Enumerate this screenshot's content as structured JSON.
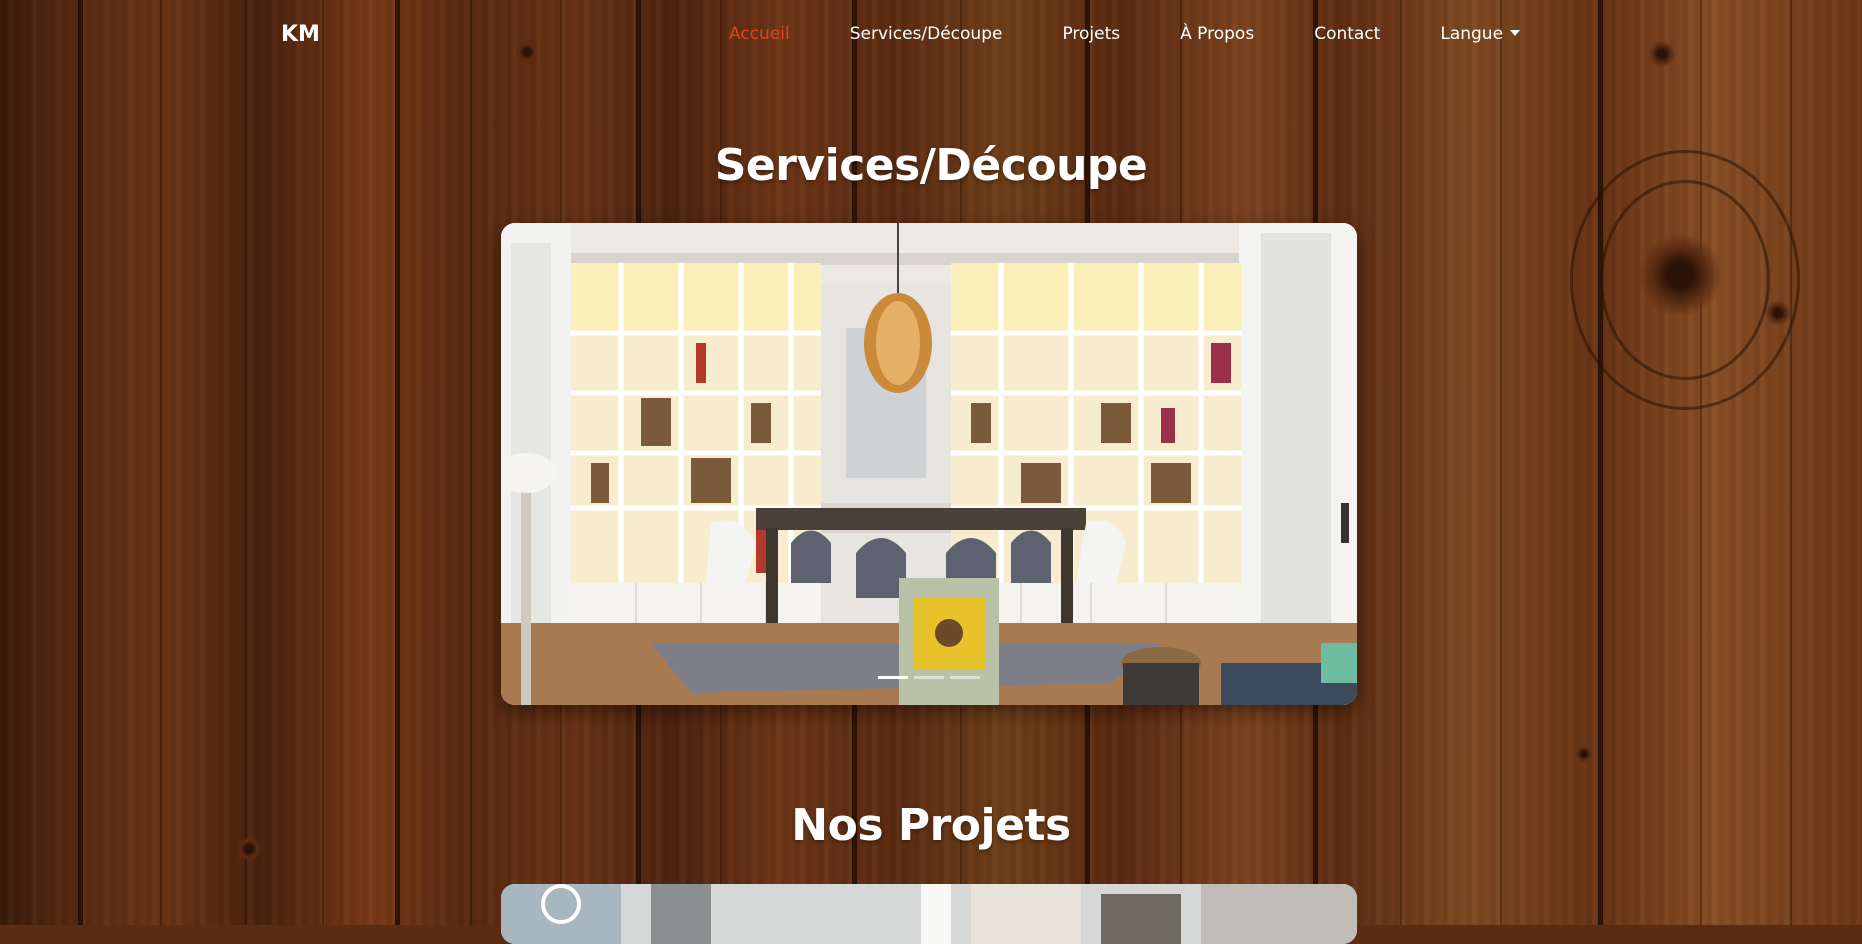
{
  "navbar": {
    "brand": "KM",
    "links": [
      {
        "label": "Accueil",
        "active": true
      },
      {
        "label": "Services/Découpe",
        "active": false
      },
      {
        "label": "Projets",
        "active": false
      },
      {
        "label": "À Propos",
        "active": false
      },
      {
        "label": "Contact",
        "active": false
      },
      {
        "label": "Langue",
        "active": false,
        "dropdown": true
      }
    ]
  },
  "services": {
    "title": "Services/Découpe",
    "carousel": {
      "slide_count": 3,
      "active_index": 0
    }
  },
  "projects": {
    "title": "Nos Projets"
  },
  "colors": {
    "accent": "#e8401c",
    "text": "#ffffff"
  }
}
